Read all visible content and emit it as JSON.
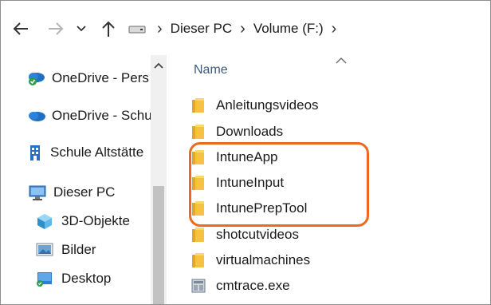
{
  "toolbar": {
    "back_icon": "arrow-left-icon",
    "forward_icon": "arrow-right-icon",
    "recent_icon": "chevron-down-icon",
    "up_icon": "arrow-up-icon"
  },
  "breadcrumb": {
    "drive_icon": "drive-icon",
    "items": [
      "Dieser PC",
      "Volume (F:)"
    ]
  },
  "sidebar": {
    "items": [
      {
        "label": "OneDrive - Pers",
        "icon": "onedrive-synced-icon"
      },
      {
        "label": "OneDrive - Schu",
        "icon": "onedrive-icon"
      },
      {
        "label": "Schule Altstätte",
        "icon": "building-icon"
      },
      {
        "label": "Dieser PC",
        "icon": "computer-icon"
      },
      {
        "label": "3D-Objekte",
        "icon": "3d-objects-icon"
      },
      {
        "label": "Bilder",
        "icon": "pictures-icon"
      },
      {
        "label": "Desktop",
        "icon": "desktop-icon"
      }
    ]
  },
  "filelist": {
    "column_header": "Name",
    "items": [
      {
        "label": "Anleitungsvideos",
        "icon": "folder-icon"
      },
      {
        "label": "Downloads",
        "icon": "folder-icon"
      },
      {
        "label": "IntuneApp",
        "icon": "folder-icon"
      },
      {
        "label": "IntuneInput",
        "icon": "folder-icon"
      },
      {
        "label": "IntunePrepTool",
        "icon": "folder-icon"
      },
      {
        "label": "shotcutvideos",
        "icon": "folder-icon"
      },
      {
        "label": "virtualmachines",
        "icon": "folder-icon"
      },
      {
        "label": "cmtrace.exe",
        "icon": "exe-file-icon"
      }
    ]
  },
  "colors": {
    "highlight": "#ed6a1d",
    "folder": "#f5c242",
    "header_text": "#3d5a80"
  }
}
